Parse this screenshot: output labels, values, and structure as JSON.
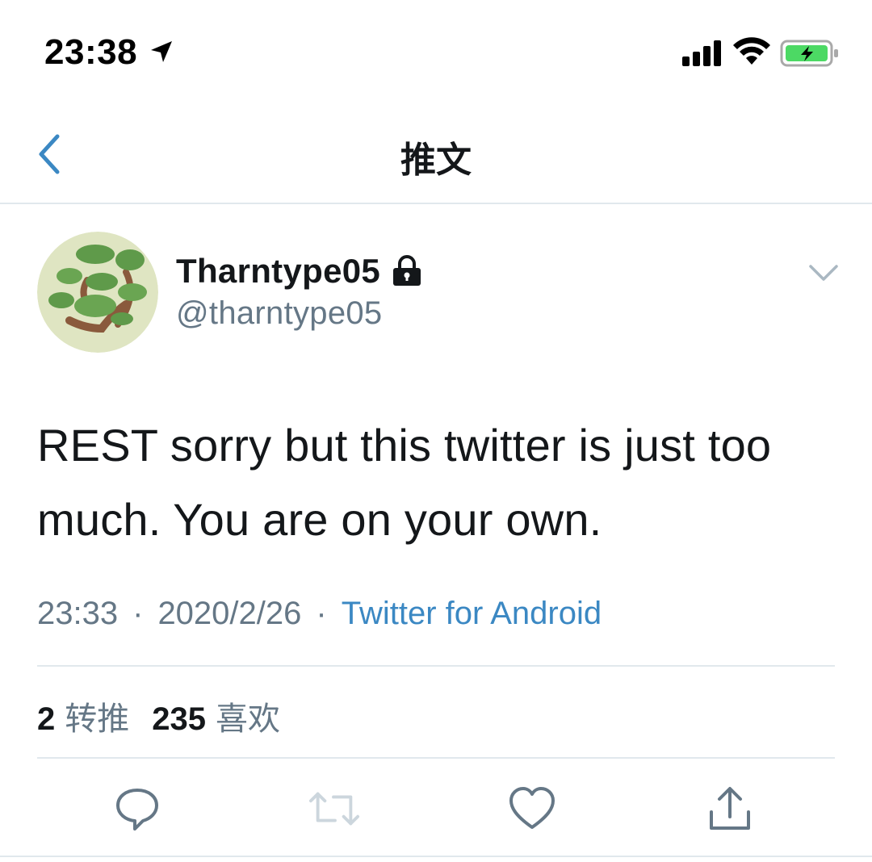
{
  "status_bar": {
    "time": "23:38"
  },
  "nav": {
    "title": "推文",
    "back_icon": "chevron-left-icon"
  },
  "tweet": {
    "display_name": "Tharntype05",
    "handle": "@tharntype05",
    "protected": true,
    "text": "REST sorry but this twitter is just too much. You are on your own.",
    "time": "23:33",
    "date": "2020/2/26",
    "separator": "·",
    "source": "Twitter for Android",
    "stats": {
      "retweets_count": "2",
      "retweets_label": "转推",
      "likes_count": "235",
      "likes_label": "喜欢"
    }
  },
  "actions": {
    "icons": [
      "reply-icon",
      "retweet-icon",
      "like-icon",
      "share-icon"
    ]
  },
  "colors": {
    "accent": "#3b88c3",
    "secondary_text": "#657786",
    "divider": "#e1e8ed",
    "battery_fill": "#4cd964"
  }
}
